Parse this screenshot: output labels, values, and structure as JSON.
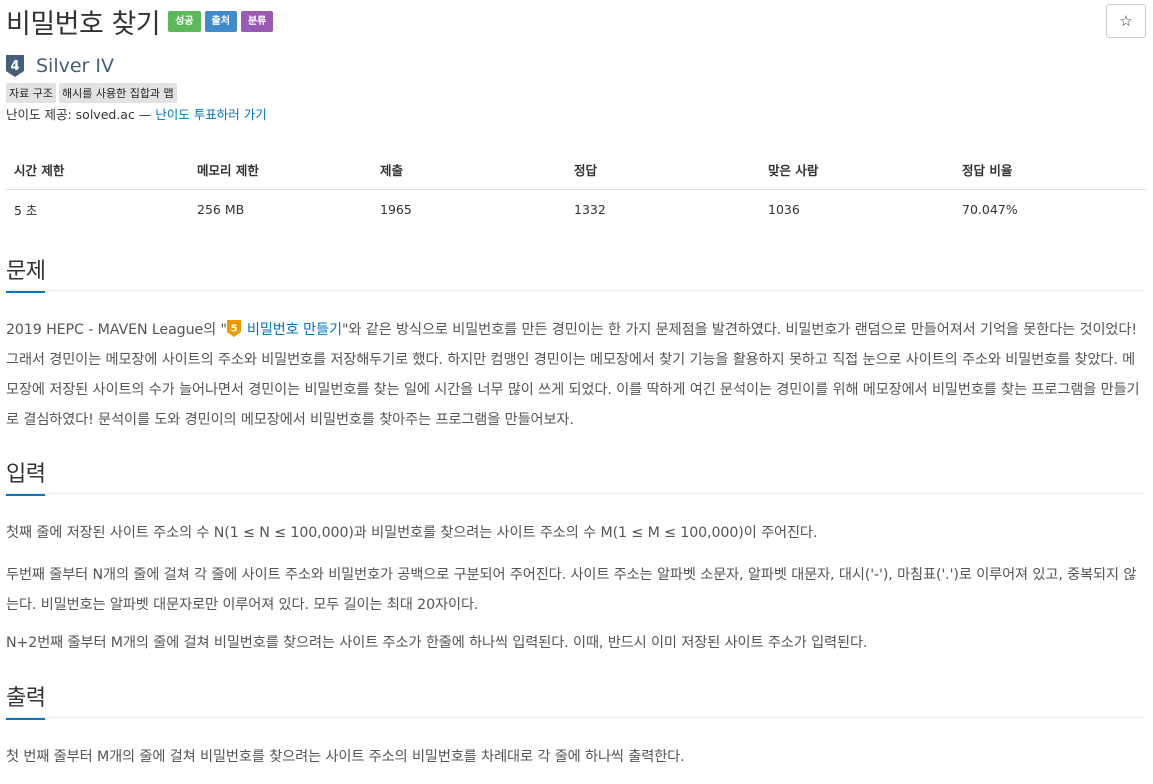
{
  "title": "비밀번호 찾기",
  "badges": [
    {
      "label": "성공",
      "color": "#5cb85c"
    },
    {
      "label": "출처",
      "color": "#428bca"
    },
    {
      "label": "분류",
      "color": "#9b59b6"
    }
  ],
  "star": "☆",
  "tier": {
    "number": "4",
    "name": "Silver IV",
    "color": "#435f7a"
  },
  "tags": [
    "자료 구조",
    "해시를 사용한 집합과 맵"
  ],
  "credit": {
    "prefix": "난이도 제공: solved.ac — ",
    "link": "난이도 투표하러 가기"
  },
  "stats": {
    "headers": [
      "시간 제한",
      "메모리 제한",
      "제출",
      "정답",
      "맞은 사람",
      "정답 비율"
    ],
    "values": [
      "5 초",
      "256 MB",
      "1965",
      "1332",
      "1036",
      "70.047%"
    ]
  },
  "problem": {
    "heading": "문제",
    "text_before": "2019 HEPC - MAVEN League의 \"",
    "link_tier": "5",
    "link": "비밀번호 만들기",
    "text_after": "\"와 같은 방식으로 비밀번호를 만든 경민이는 한 가지 문제점을 발견하였다. 비밀번호가 랜덤으로 만들어져서 기억을 못한다는 것이었다! 그래서 경민이는 메모장에 사이트의 주소와 비밀번호를 저장해두기로 했다. 하지만 컴맹인 경민이는 메모장에서 찾기 기능을 활용하지 못하고 직접 눈으로 사이트의 주소와 비밀번호를 찾았다. 메모장에 저장된 사이트의 수가 늘어나면서 경민이는 비밀번호를 찾는 일에 시간을 너무 많이 쓰게 되었다. 이를 딱하게 여긴 문석이는 경민이를 위해 메모장에서 비밀번호를 찾는 프로그램을 만들기로 결심하였다! 문석이를 도와 경민이의 메모장에서 비밀번호를 찾아주는 프로그램을 만들어보자."
  },
  "input": {
    "heading": "입력",
    "paragraphs": [
      "첫째 줄에 저장된 사이트 주소의 수 N(1 ≤ N ≤ 100,000)과 비밀번호를 찾으려는 사이트 주소의 수 M(1 ≤ M ≤ 100,000)이 주어진다.",
      "두번째 줄부터 N개의 줄에 걸쳐 각 줄에 사이트 주소와 비밀번호가 공백으로 구분되어 주어진다. 사이트 주소는 알파벳 소문자, 알파벳 대문자, 대시('-'), 마침표('.')로 이루어져 있고, 중복되지 않는다. 비밀번호는 알파벳 대문자로만 이루어져 있다. 모두 길이는 최대 20자이다.",
      "N+2번째 줄부터 M개의 줄에 걸쳐 비밀번호를 찾으려는 사이트 주소가 한줄에 하나씩 입력된다. 이때, 반드시 이미 저장된 사이트 주소가 입력된다."
    ]
  },
  "output": {
    "heading": "출력",
    "paragraphs": [
      "첫 번째 줄부터 M개의 줄에 걸쳐 비밀번호를 찾으려는 사이트 주소의 비밀번호를 차례대로 각 줄에 하나씩 출력한다."
    ]
  }
}
